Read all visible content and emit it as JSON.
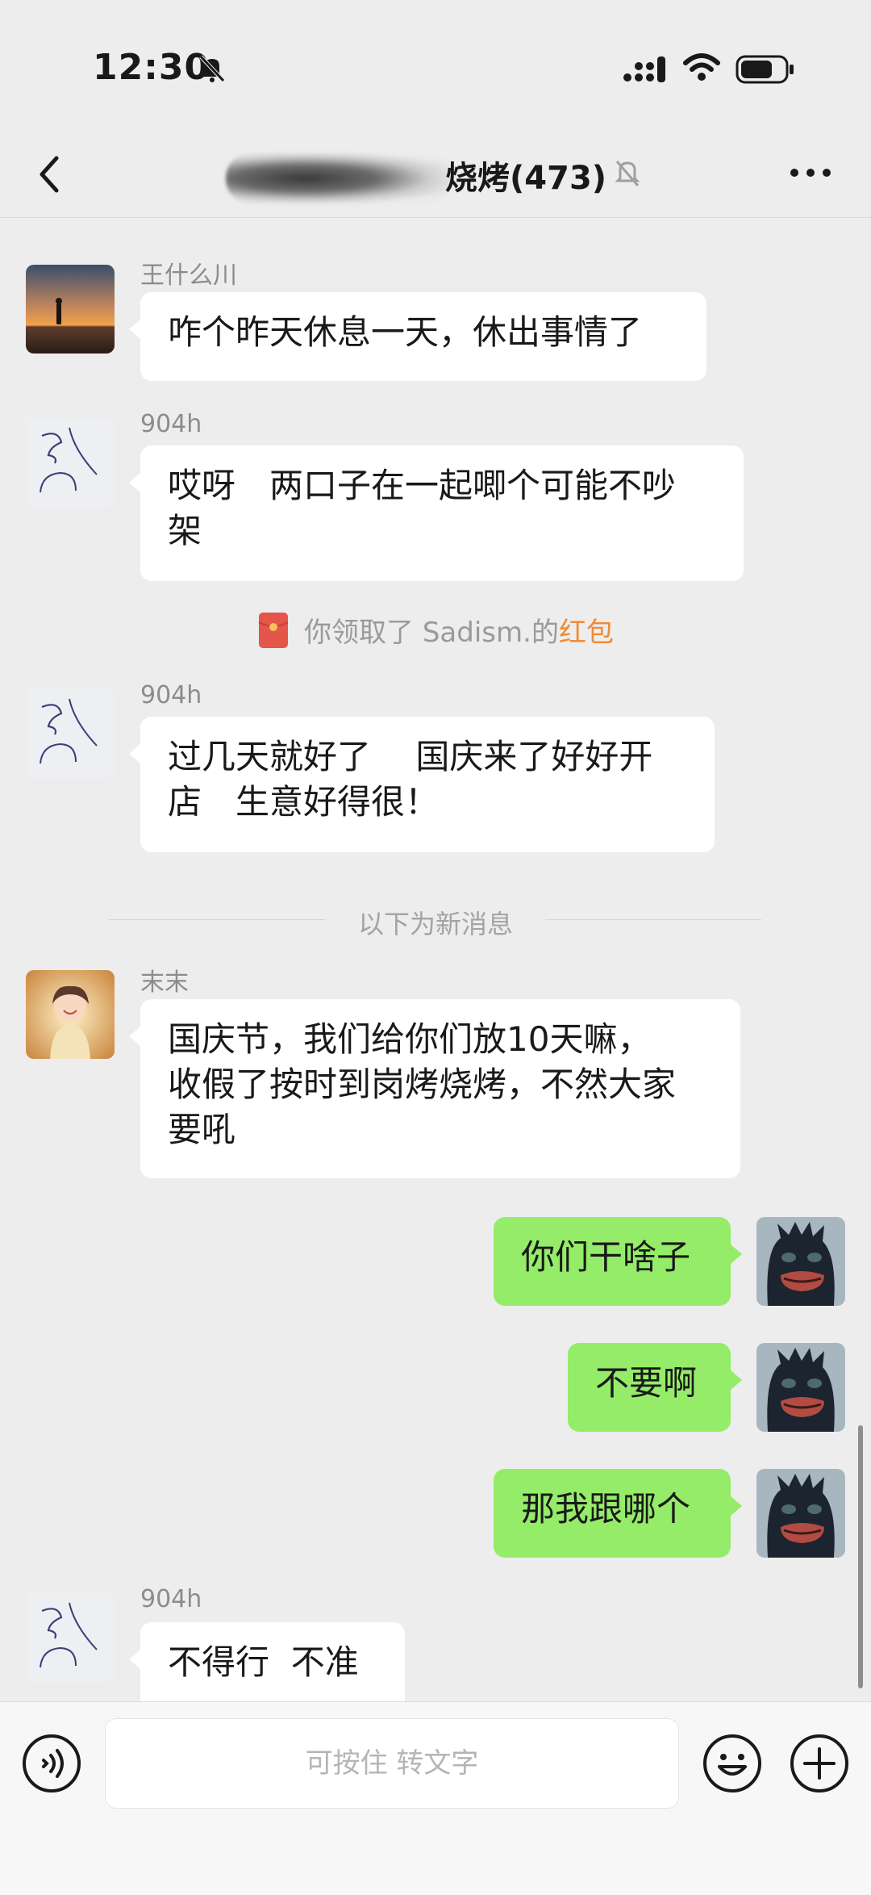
{
  "status_bar": {
    "time": "12:30",
    "icons": [
      "bell-slash-icon",
      "signal-icon",
      "wifi-icon",
      "battery-icon"
    ]
  },
  "header": {
    "title_visible": "烧烤(473)",
    "back_icon": "chevron-left-icon",
    "mute_icon": "bell-slash-icon",
    "more_icon": "more-dots-icon"
  },
  "messages": [
    {
      "sender": "王什么川",
      "text": "咋个昨天休息一天，休出事情了",
      "side": "left"
    },
    {
      "sender": "904h",
      "text": "哎呀　两口子在一起唧个可能不吵\n架",
      "side": "left"
    },
    {
      "sender": "904h",
      "text": "过几天就好了　 国庆来了好好开\n店　生意好得很！",
      "side": "left"
    },
    {
      "sender": "末末",
      "text": "国庆节，我们给你们放10天嘛，\n收假了按时到岗烤烧烤，不然大家\n要吼",
      "side": "left"
    },
    {
      "text": "你们干啥子",
      "side": "right"
    },
    {
      "text": "不要啊",
      "side": "right"
    },
    {
      "text": "那我跟哪个",
      "side": "right"
    },
    {
      "sender": "904h",
      "text": "不得行  不准",
      "side": "left"
    }
  ],
  "system": {
    "redpacket_prefix": "你领取了 Sadism.的",
    "redpacket_link": "红包",
    "new_messages_divider": "以下为新消息"
  },
  "input_bar": {
    "placeholder": "可按住 转文字",
    "left_icon": "voice-icon",
    "right_icons": [
      "emoji-icon",
      "plus-icon"
    ]
  },
  "colors": {
    "background": "#ededed",
    "my_bubble": "#95ec69",
    "other_bubble": "#ffffff",
    "link_orange": "#f08a33",
    "redpacket_red": "#e4554a"
  }
}
